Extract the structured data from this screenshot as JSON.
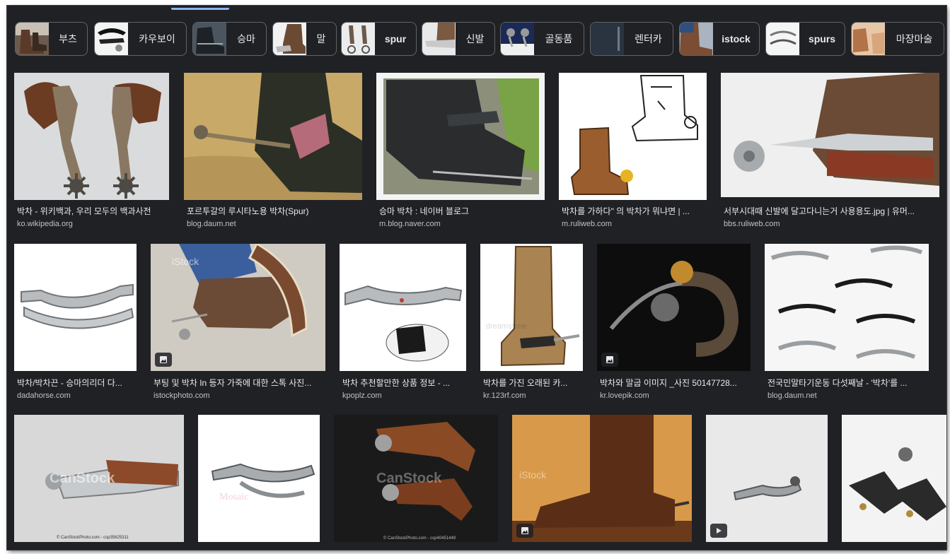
{
  "chips": [
    {
      "label": "부츠",
      "en": false
    },
    {
      "label": "카우보이",
      "en": false
    },
    {
      "label": "승마",
      "en": false
    },
    {
      "label": "말",
      "en": false
    },
    {
      "label": "spur",
      "en": true
    },
    {
      "label": "신발",
      "en": false
    },
    {
      "label": "골동품",
      "en": false
    },
    {
      "label": "렌터카",
      "en": false
    },
    {
      "label": "istock",
      "en": true
    },
    {
      "label": "spurs",
      "en": true
    },
    {
      "label": "마장마술",
      "en": false
    }
  ],
  "results": [
    {
      "title": "박차 - 위키백과, 우리 모두의 백과사전",
      "source": "ko.wikipedia.org"
    },
    {
      "title": "포르투갈의 루시타노용 박차(Spur)",
      "source": "blog.daum.net"
    },
    {
      "title": "승마 박차 : 네이버 블로그",
      "source": "m.blog.naver.com"
    },
    {
      "title": "박차를 가하다\" 의 박차가 뭐냐면 | ...",
      "source": "m.ruliweb.com"
    },
    {
      "title": "서부시대때 신발에 달고다니는거 사용용도.jpg | 유머...",
      "source": "bbs.ruliweb.com"
    },
    {
      "title": "박차/박차끈 - 승마의리더 다...",
      "source": "dadahorse.com"
    },
    {
      "title": "부팅 및 박차 In 등자 가죽에 대한 스톡 사진...",
      "source": "istockphoto.com"
    },
    {
      "title": "박차 추천할만한 상품 정보 - ...",
      "source": "kpoplz.com"
    },
    {
      "title": "박차를 가진 오래된 카...",
      "source": "kr.123rf.com"
    },
    {
      "title": "박차와 말굽 이미지 _사진 50147728...",
      "source": "kr.lovepik.com"
    },
    {
      "title": "전국민말타기운동 다섯째날 - '박차'를 ...",
      "source": "blog.daum.net"
    }
  ],
  "image_watermarks": {
    "result_6": "iStock",
    "result_9": "dreamstime",
    "row3_1": "CanStock",
    "row3_1_caption": "© CanStockPhoto.com - csp35625311",
    "row3_3": "CanStock",
    "row3_3_caption": "© CanStockPhoto.com - csp40451449",
    "row3_4": "iStock",
    "row3_2": "Mosaic"
  },
  "icons": {
    "image_badge": "image-icon",
    "video_badge": "play-icon"
  },
  "colors": {
    "background": "#202124",
    "chip_border": "#5f6368",
    "text_primary": "#e8eaed",
    "text_secondary": "#bdc1c6",
    "accent": "#8ab4f8"
  }
}
